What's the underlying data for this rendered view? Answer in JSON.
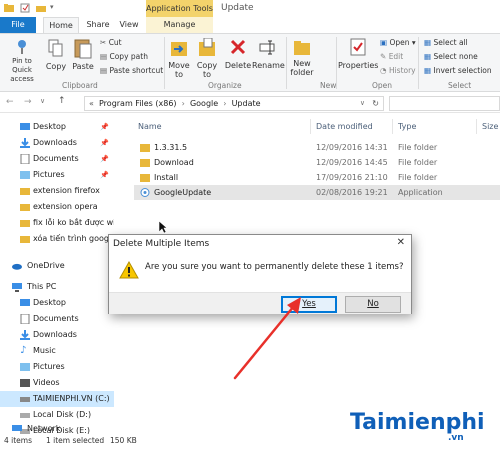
{
  "window": {
    "contextual_tab_group": "Application Tools",
    "title": "Update"
  },
  "tabs": {
    "file": "File",
    "home": "Home",
    "share": "Share",
    "view": "View",
    "manage": "Manage"
  },
  "ribbon": {
    "clipboard": {
      "pin": "Pin to Quick access",
      "copy": "Copy",
      "paste": "Paste",
      "cut": "Cut",
      "copy_path": "Copy path",
      "paste_shortcut": "Paste shortcut",
      "label": "Clipboard"
    },
    "organize": {
      "move_to": "Move to",
      "copy_to": "Copy to",
      "delete": "Delete",
      "rename": "Rename",
      "label": "Organize"
    },
    "new": {
      "new_folder": "New folder",
      "label": "New"
    },
    "open": {
      "properties": "Properties",
      "open": "Open",
      "edit": "Edit",
      "history": "History",
      "label": "Open"
    },
    "select": {
      "select_all": "Select all",
      "select_none": "Select none",
      "invert_selection": "Invert selection",
      "label": "Select"
    }
  },
  "address": {
    "segments": [
      "Program Files (x86)",
      "Google",
      "Update"
    ]
  },
  "nav": {
    "items": [
      {
        "label": "Desktop",
        "pinned": true
      },
      {
        "label": "Downloads",
        "pinned": true
      },
      {
        "label": "Documents",
        "pinned": true
      },
      {
        "label": "Pictures",
        "pinned": true
      },
      {
        "label": "extension firefox"
      },
      {
        "label": "extension opera"
      },
      {
        "label": "fix lỗi ko bắt được wi"
      },
      {
        "label": "xóa tiến trình google"
      },
      {
        "label": "OneDrive"
      },
      {
        "label": "This PC"
      },
      {
        "label": "Desktop"
      },
      {
        "label": "Documents"
      },
      {
        "label": "Downloads"
      },
      {
        "label": "Music"
      },
      {
        "label": "Pictures"
      },
      {
        "label": "Videos"
      },
      {
        "label": "TAIMIENPHI.VN (C:)"
      },
      {
        "label": "Local Disk (D:)"
      },
      {
        "label": "Local Disk (E:)"
      },
      {
        "label": "Network"
      }
    ]
  },
  "columns": {
    "name": "Name",
    "date": "Date modified",
    "type": "Type",
    "size": "Size"
  },
  "files": [
    {
      "name": "1.3.31.5",
      "date": "12/09/2016 14:31",
      "type": "File folder"
    },
    {
      "name": "Download",
      "date": "12/09/2016 14:45",
      "type": "File folder"
    },
    {
      "name": "Install",
      "date": "17/09/2016 21:10",
      "type": "File folder"
    },
    {
      "name": "GoogleUpdate",
      "date": "02/08/2016 19:21",
      "type": "Application"
    }
  ],
  "status": {
    "items": "4 items",
    "selected": "1 item selected",
    "size": "150 KB"
  },
  "dialog": {
    "title": "Delete Multiple Items",
    "message": "Are you sure you want to permanently delete these 1 items?",
    "yes": "Yes",
    "no": "No",
    "close": "✕"
  },
  "watermark": {
    "brand": "Taimienphi",
    "tld": ".vn"
  },
  "colors": {
    "file_tab": "#1979ca",
    "app_tools": "#f3d36b",
    "selection": "#cce8ff",
    "arrow": "#e8302a",
    "watermark": "#0f5fb8"
  }
}
